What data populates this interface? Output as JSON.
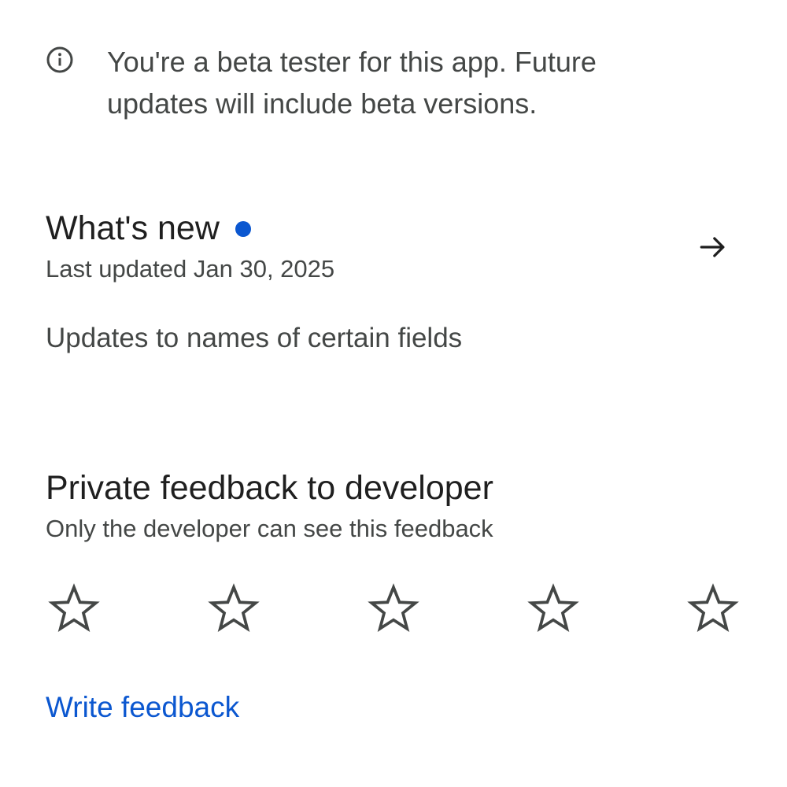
{
  "beta_banner": {
    "icon": "info-icon",
    "text": "You're a beta tester for this app. Future updates will include beta versions."
  },
  "whats_new": {
    "title": "What's new",
    "last_updated": "Last updated Jan 30, 2025",
    "arrow_icon": "arrow-right-icon",
    "notes": "Updates to names of certain fields",
    "dot_color": "#0b57d0"
  },
  "feedback": {
    "title": "Private feedback to developer",
    "subtitle": "Only the developer can see this feedback",
    "rating": 0,
    "max_rating": 5,
    "star_icon": "star-outline-icon",
    "write_label": "Write feedback"
  },
  "colors": {
    "primary_text": "#1f1f1f",
    "secondary_text": "#444746",
    "accent": "#0b57d0",
    "icon": "#444746"
  }
}
